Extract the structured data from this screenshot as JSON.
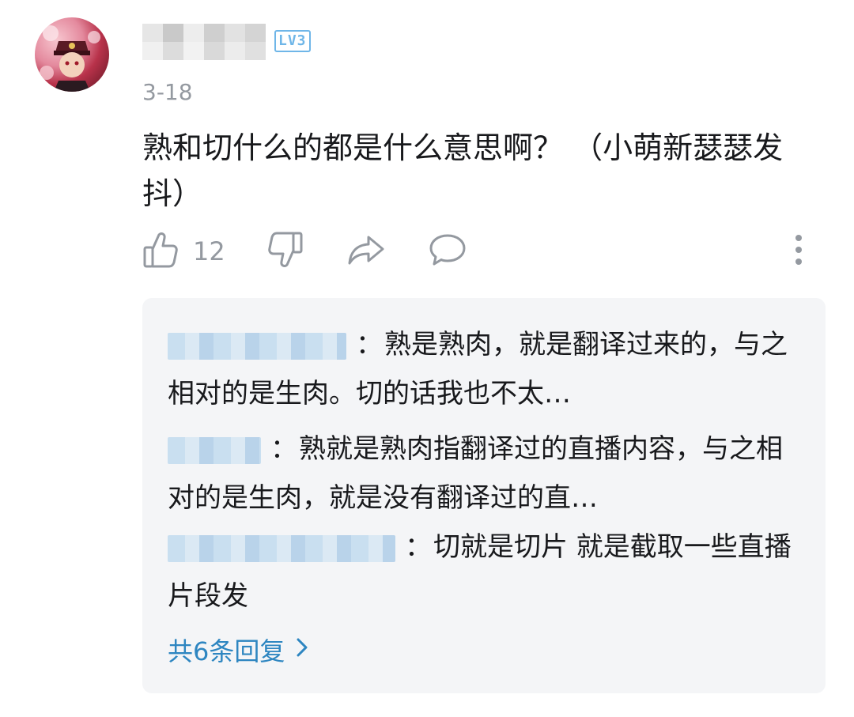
{
  "comment": {
    "level": "LV3",
    "date": "3-18",
    "text": "熟和切什么的都是什么意思啊？ （小萌新瑟瑟发抖）",
    "like_count": "12"
  },
  "replies": [
    {
      "separator": "：",
      "text": "熟是熟肉，就是翻译过来的，与之相对的是生肉。切的话我也不太…"
    },
    {
      "separator": "：",
      "text": "熟就是熟肉指翻译过的直播内容，与之相对的是生肉，就是没有翻译过的直…"
    },
    {
      "separator": "：",
      "text": "切就是切片 就是截取一些直播片段发"
    }
  ],
  "total_replies_label": "共6条回复",
  "colors": {
    "link": "#2e86c1",
    "meta": "#9499a0",
    "reply_bg": "#f4f5f7",
    "level_badge": "#6fb6e8"
  },
  "icons": [
    "thumbs-up-icon",
    "thumbs-down-icon",
    "share-icon",
    "comment-icon",
    "more-vertical-icon",
    "chevron-right-icon"
  ]
}
